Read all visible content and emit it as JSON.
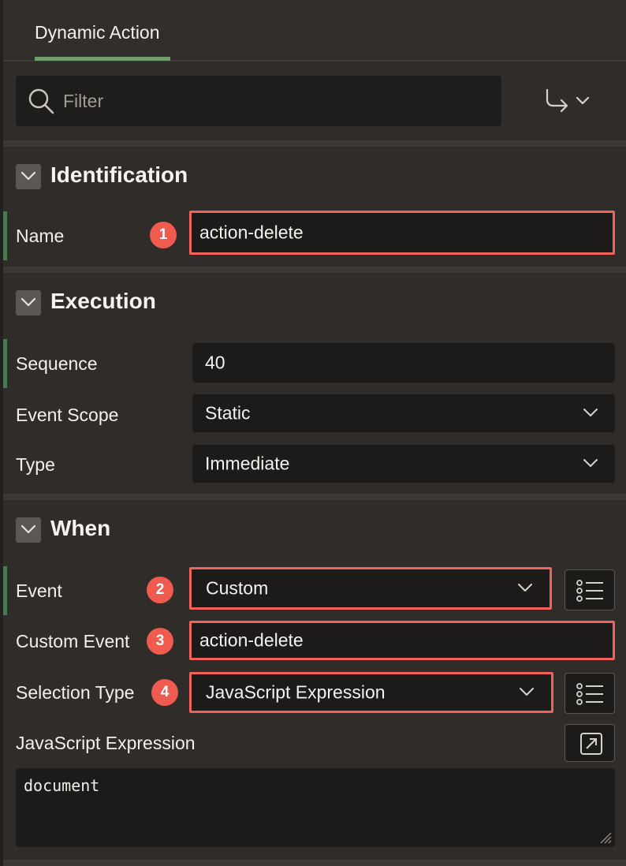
{
  "tabs": [
    {
      "label": "Dynamic Action",
      "active": true
    }
  ],
  "filter": {
    "placeholder": "Filter",
    "value": ""
  },
  "sections": {
    "identification": {
      "title": "Identification",
      "name": {
        "label": "Name",
        "value": "action-delete",
        "callout": "1"
      }
    },
    "execution": {
      "title": "Execution",
      "sequence": {
        "label": "Sequence",
        "value": "40"
      },
      "event_scope": {
        "label": "Event Scope",
        "value": "Static"
      },
      "type": {
        "label": "Type",
        "value": "Immediate"
      }
    },
    "when": {
      "title": "When",
      "event": {
        "label": "Event",
        "value": "Custom",
        "callout": "2"
      },
      "custom_event": {
        "label": "Custom Event",
        "value": "action-delete",
        "callout": "3"
      },
      "selection_type": {
        "label": "Selection Type",
        "value": "JavaScript Expression",
        "callout": "4"
      },
      "js_expression": {
        "label": "JavaScript Expression",
        "value": "document"
      }
    }
  },
  "icons": {
    "filter": "search-icon",
    "goto": "go-to-group-icon",
    "collapse": "chevron-down-icon",
    "list": "list-icon",
    "expand": "open-in-dialog-icon"
  },
  "colors": {
    "background": "#2f2c2a",
    "field": "#1c1b1a",
    "accent": "#6f9d6b",
    "callout": "#ef5b4f"
  }
}
